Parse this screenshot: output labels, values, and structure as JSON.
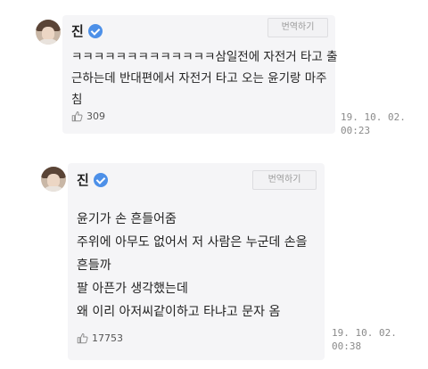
{
  "posts": [
    {
      "author": "진",
      "translate_label": "번역하기",
      "lines": [
        "ㅋㅋㅋㅋㅋㅋㅋㅋㅋㅋㅋㅋㅋ삼일전에 자전거 타고 출",
        "근하는데 반대편에서 자전거 타고 오는 윤기랑 마주",
        "침"
      ],
      "likes": "309",
      "date": "19. 10. 02.",
      "time": "00:23"
    },
    {
      "author": "진",
      "translate_label": "번역하기",
      "lines": [
        "윤기가 손 흔들어줌",
        "주위에 아무도 없어서 저 사람은 누군데 손을",
        "흔들까",
        "팔 아픈가 생각했는데",
        "왜 이리 아저씨같이하고 타냐고 문자 옴"
      ],
      "likes": "17753",
      "date": "19. 10. 02.",
      "time": "00:38"
    }
  ],
  "colors": {
    "card_background": "#f5f5f7",
    "verified_badge": "#4d90e8",
    "timestamp": "#8a8a8a"
  },
  "icons": {
    "verified": "verified-badge-icon",
    "like": "thumbs-up-icon"
  }
}
